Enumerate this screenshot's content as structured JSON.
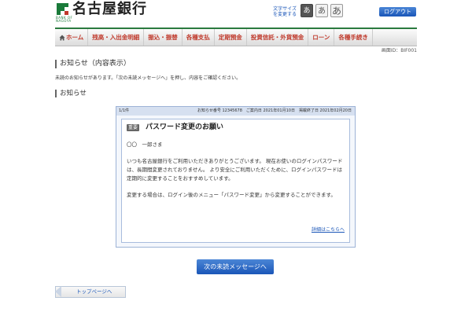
{
  "header": {
    "bank_name": "名古屋銀行",
    "bank_sub": "BANK OF NAGOYA",
    "font_size_label": "文字サイズを変更する",
    "font_sizes": [
      "あ",
      "あ",
      "あ"
    ],
    "logout_label": "ログアウト"
  },
  "nav": {
    "items": [
      {
        "label": "ホーム"
      },
      {
        "label": "残高・入出金明細"
      },
      {
        "label": "振込・振替"
      },
      {
        "label": "各種支払"
      },
      {
        "label": "定期預金"
      },
      {
        "label": "投資信託・外貨預金"
      },
      {
        "label": "ローン"
      },
      {
        "label": "各種手続き"
      }
    ]
  },
  "screen_id": "画面ID：BIF001",
  "page_title": "お知らせ（内容表示）",
  "intro_text": "未読のお知らせがあります。「次の未読メッセージへ」を押し、内容をご確認ください。",
  "section_title": "お知らせ",
  "message": {
    "count": "1/1件",
    "meta": "お知らせ番号 12345678　ご案内日 2021年01月10日　掲載終了日 2021年02月20日",
    "badge": "重要",
    "title": "パスワード変更のお願い",
    "recipient": "〇〇　一郎さま",
    "body": [
      "いつも名古屋銀行をご利用いただきありがとうございます。 現在お使いのログインパスワードは、長期間変更されておりません。 より安全にご利用いただくために、ログインパスワードは定期的に変更することをおすすめしています。",
      "変更する場合は、ログイン後のメニュー「パスワード変更」から変更することができます。"
    ],
    "detail_link": "詳細はこちらへ"
  },
  "next_button": "次の未読メッセージへ",
  "top_button": "トップページへ",
  "colors": {
    "brand_green": "#2a7a3f",
    "accent_blue": "#1a56b8",
    "nav_red": "#c0392b"
  }
}
